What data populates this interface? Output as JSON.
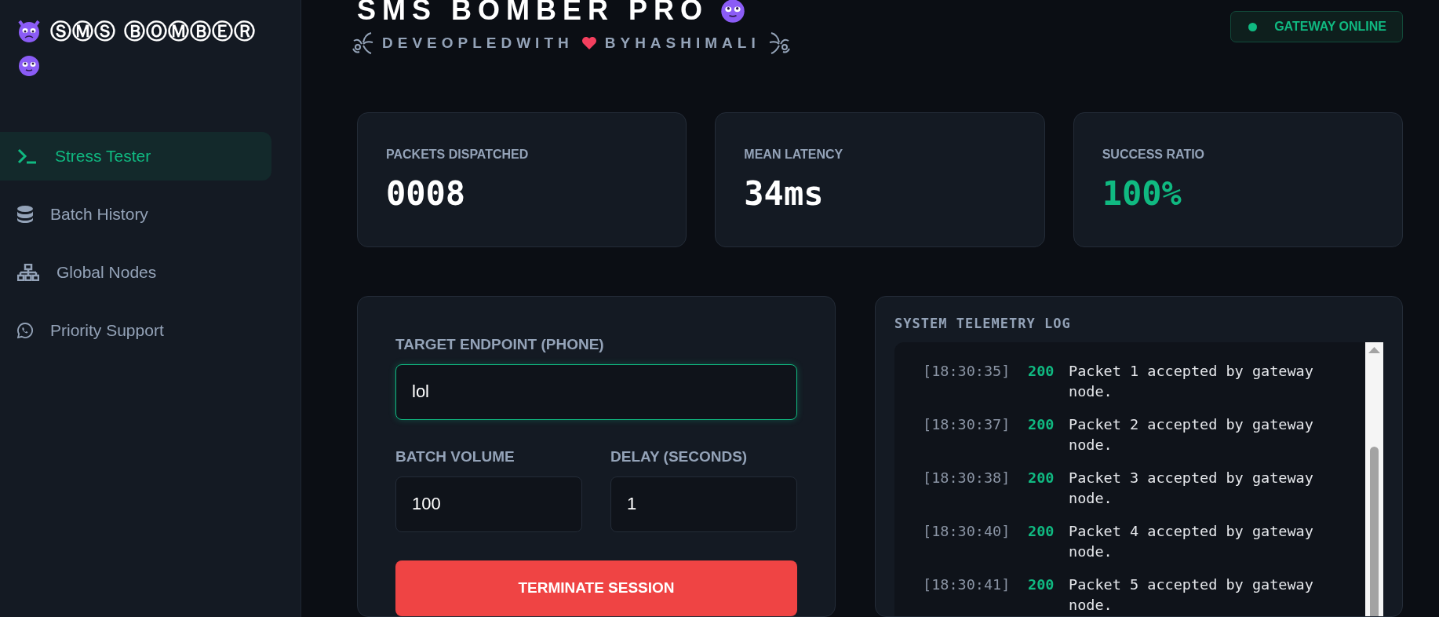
{
  "sidebar": {
    "logo": "ⓈⓂⓈ ⒷⓄⓂⒷⒺⓇ",
    "items": [
      {
        "label": "Stress Tester",
        "kind": "terminal",
        "selected": true
      },
      {
        "label": "Batch History",
        "kind": "database",
        "selected": false
      },
      {
        "label": "Global Nodes",
        "kind": "network",
        "selected": false
      },
      {
        "label": "Priority Support",
        "kind": "chat",
        "selected": false
      }
    ]
  },
  "header": {
    "title": "SMS BOMBER PRO",
    "subtitle_left": "DEVEOPLEDWITH",
    "subtitle_right": "BYHASHIMALI",
    "status": {
      "label": "GATEWAY ONLINE",
      "color": "#10b981"
    }
  },
  "stats": [
    {
      "label": "PACKETS DISPATCHED",
      "value": "0008",
      "kind": "plain"
    },
    {
      "label": "MEAN LATENCY",
      "value": "34ms",
      "kind": "plain"
    },
    {
      "label": "SUCCESS RATIO",
      "value": "100%",
      "kind": "good"
    }
  ],
  "form": {
    "target": {
      "label": "TARGET ENDPOINT (PHONE)",
      "value": "lol"
    },
    "volume": {
      "label": "BATCH VOLUME",
      "value": "100"
    },
    "delay": {
      "label": "DELAY (SECONDS)",
      "value": "1"
    },
    "button": "TERMINATE SESSION"
  },
  "log": {
    "title": "SYSTEM TELEMETRY LOG",
    "entries": [
      {
        "time": "[18:30:35]",
        "code": "200",
        "message": "Packet 1 accepted by gateway node."
      },
      {
        "time": "[18:30:37]",
        "code": "200",
        "message": "Packet 2 accepted by gateway node."
      },
      {
        "time": "[18:30:38]",
        "code": "200",
        "message": "Packet 3 accepted by gateway node."
      },
      {
        "time": "[18:30:40]",
        "code": "200",
        "message": "Packet 4 accepted by gateway node."
      },
      {
        "time": "[18:30:41]",
        "code": "200",
        "message": "Packet 5 accepted by gateway node."
      }
    ]
  }
}
